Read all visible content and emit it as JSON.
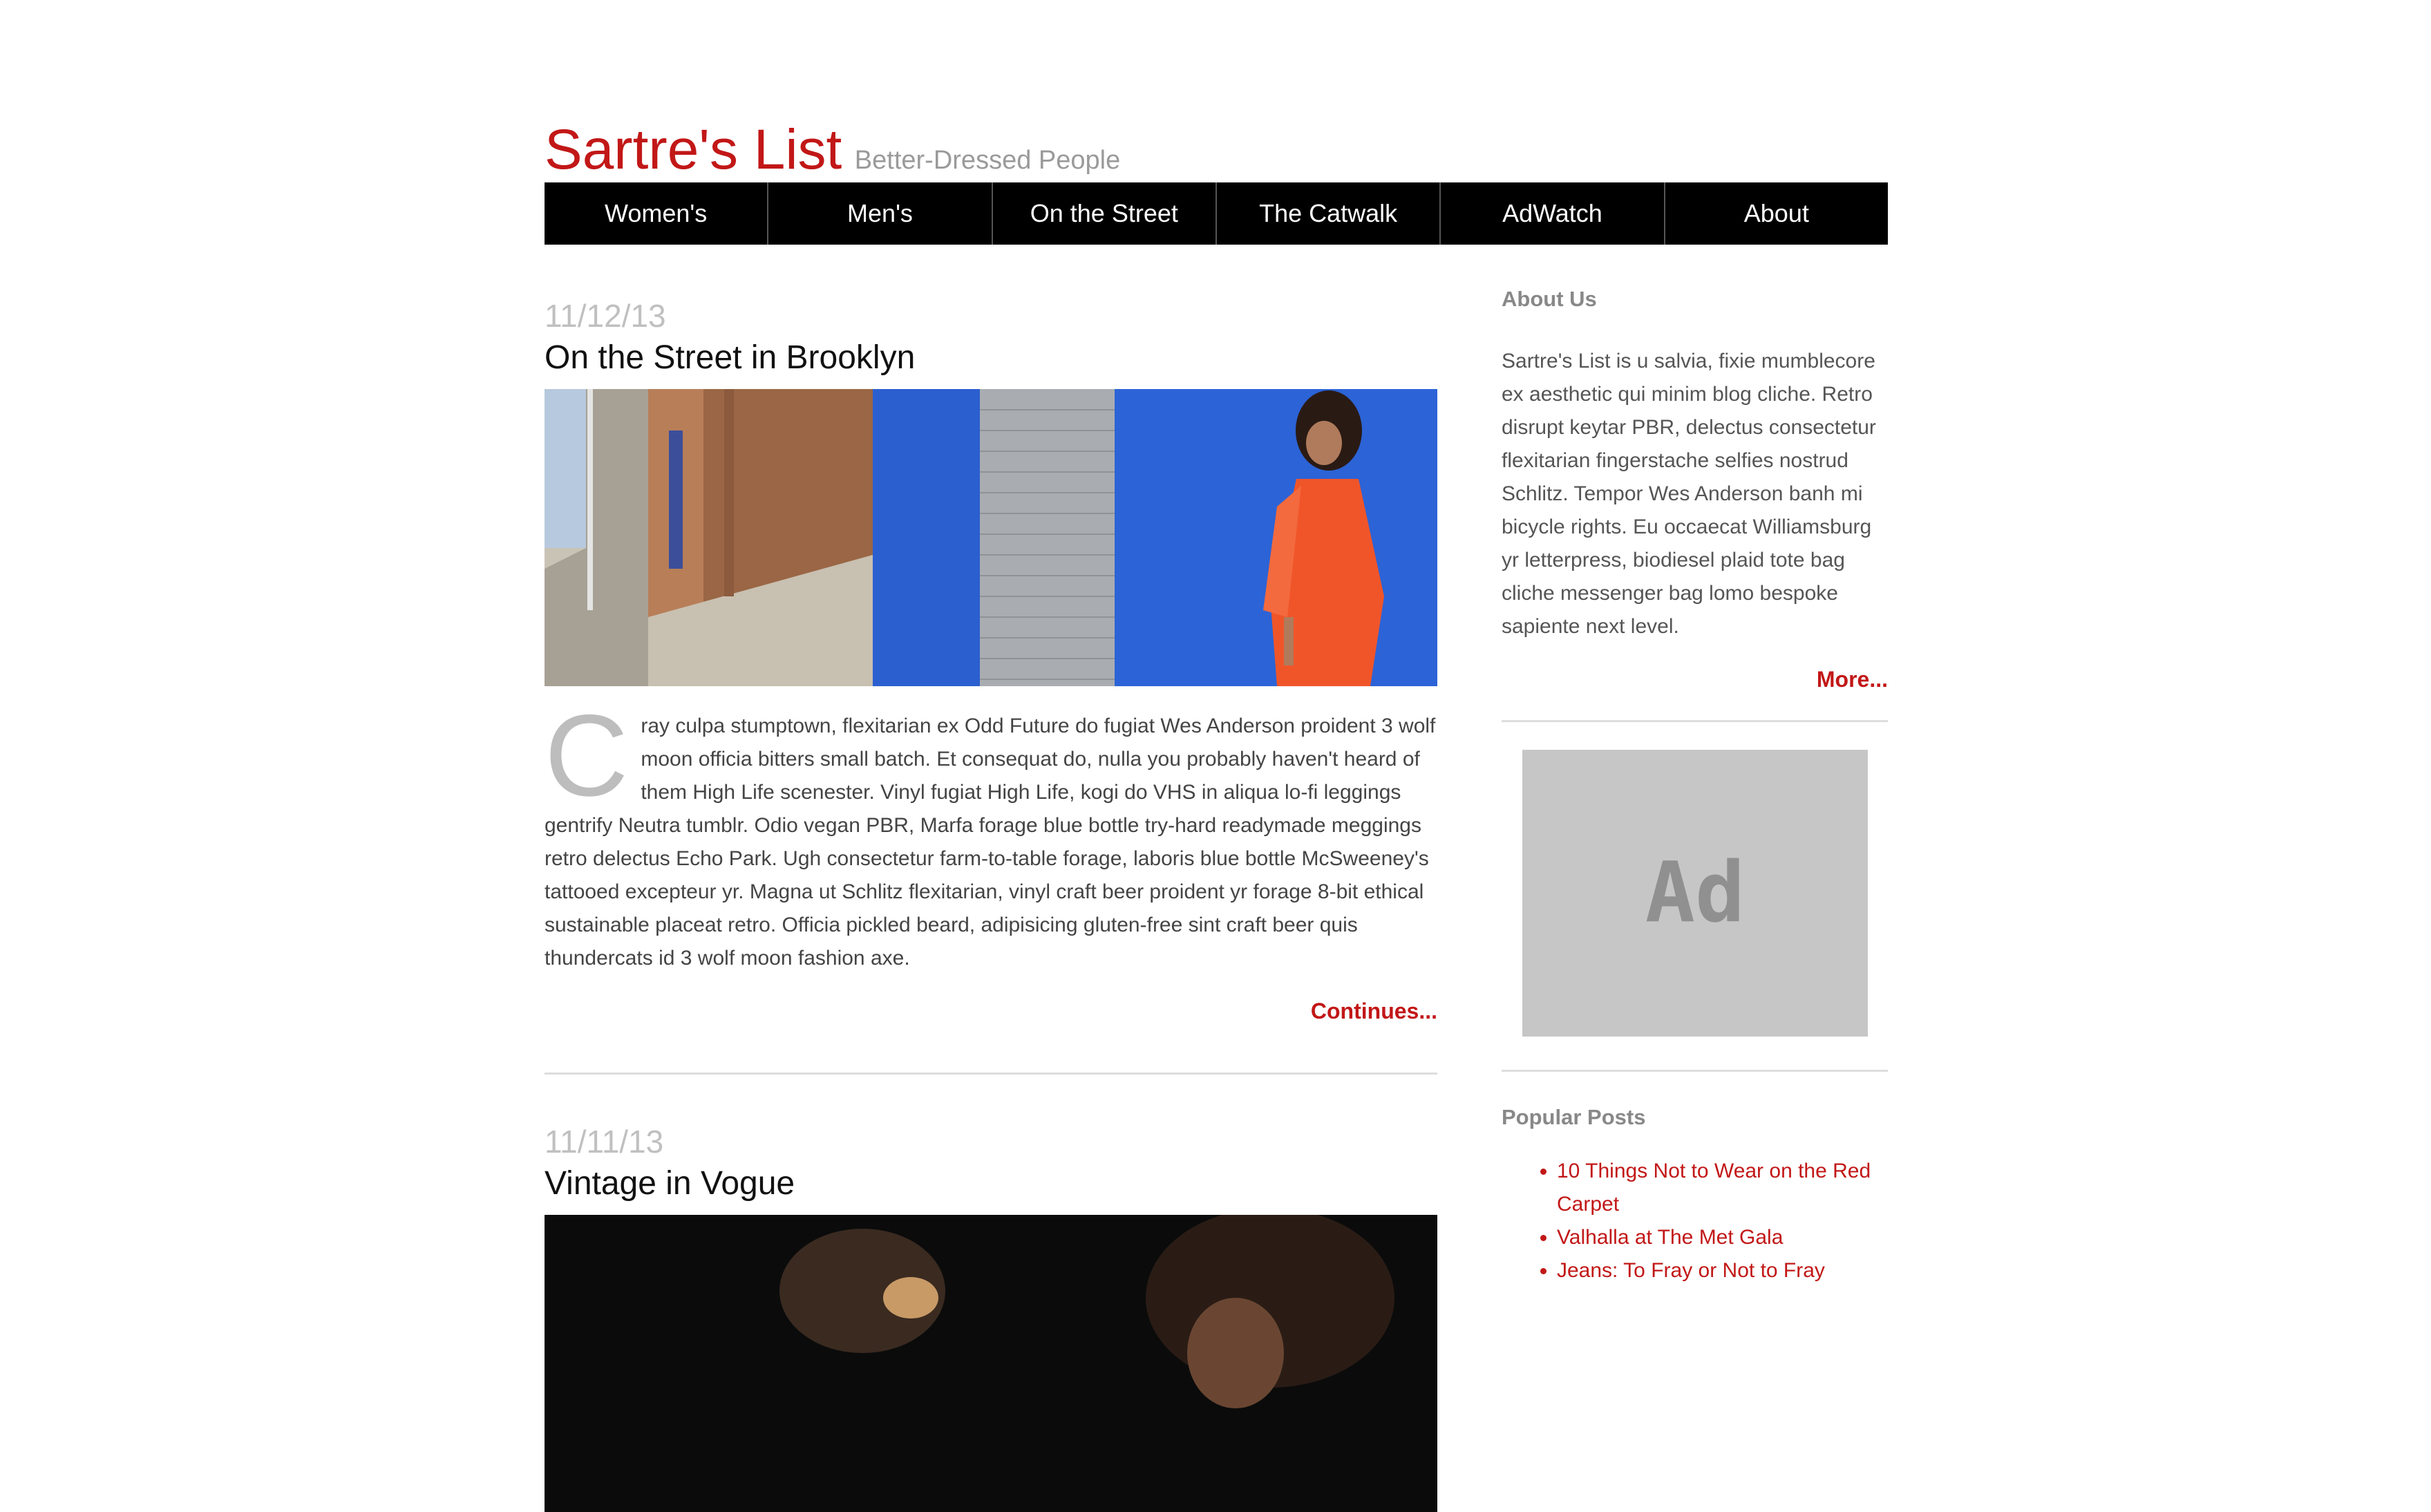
{
  "site": {
    "title": "Sartre's List",
    "tagline": "Better-Dressed People"
  },
  "nav": [
    "Women's",
    "Men's",
    "On the Street",
    "The Catwalk",
    "AdWatch",
    "About"
  ],
  "posts": [
    {
      "date": "11/12/13",
      "title": "On the Street in Brooklyn",
      "dropcap": "C",
      "body": "ray culpa stumptown, flexitarian ex Odd Future do fugiat Wes Anderson proident 3 wolf moon officia bitters small batch. Et consequat do, nulla you probably haven't heard of them High Life scenester. Vinyl fugiat High Life, kogi do VHS in aliqua lo-fi leggings gentrify Neutra tumblr. Odio vegan PBR, Marfa forage blue bottle try-hard readymade meggings retro delectus Echo Park. Ugh consectetur farm-to-table forage, laboris blue bottle McSweeney's tattooed excepteur yr. Magna ut Schlitz flexitarian, vinyl craft beer proident yr forage 8-bit ethical sustainable placeat retro. Officia pickled beard, adipisicing gluten-free sint craft beer quis thundercats id 3 wolf moon fashion axe.",
      "continue_label": "Continues..."
    },
    {
      "date": "11/11/13",
      "title": "Vintage in Vogue"
    }
  ],
  "sidebar": {
    "about_heading": "About Us",
    "about_text": "Sartre's List is u salvia, fixie mumblecore ex aesthetic qui minim blog cliche. Retro disrupt keytar PBR, delectus consectetur flexitarian fingerstache selfies nostrud Schlitz. Tempor Wes Anderson banh mi bicycle rights. Eu occaecat Williamsburg yr letterpress, biodiesel plaid tote bag cliche messenger bag lomo bespoke sapiente next level.",
    "more_label": "More...",
    "ad_label": "Ad",
    "popular_heading": "Popular Posts",
    "popular": [
      "10 Things Not to Wear on the Red Carpet",
      "Valhalla at The Met Gala",
      "Jeans: To Fray or Not to Fray"
    ]
  },
  "colors": {
    "accent": "#c21717",
    "nav_bg": "#000000",
    "ad_bg": "#c6c6c6"
  }
}
